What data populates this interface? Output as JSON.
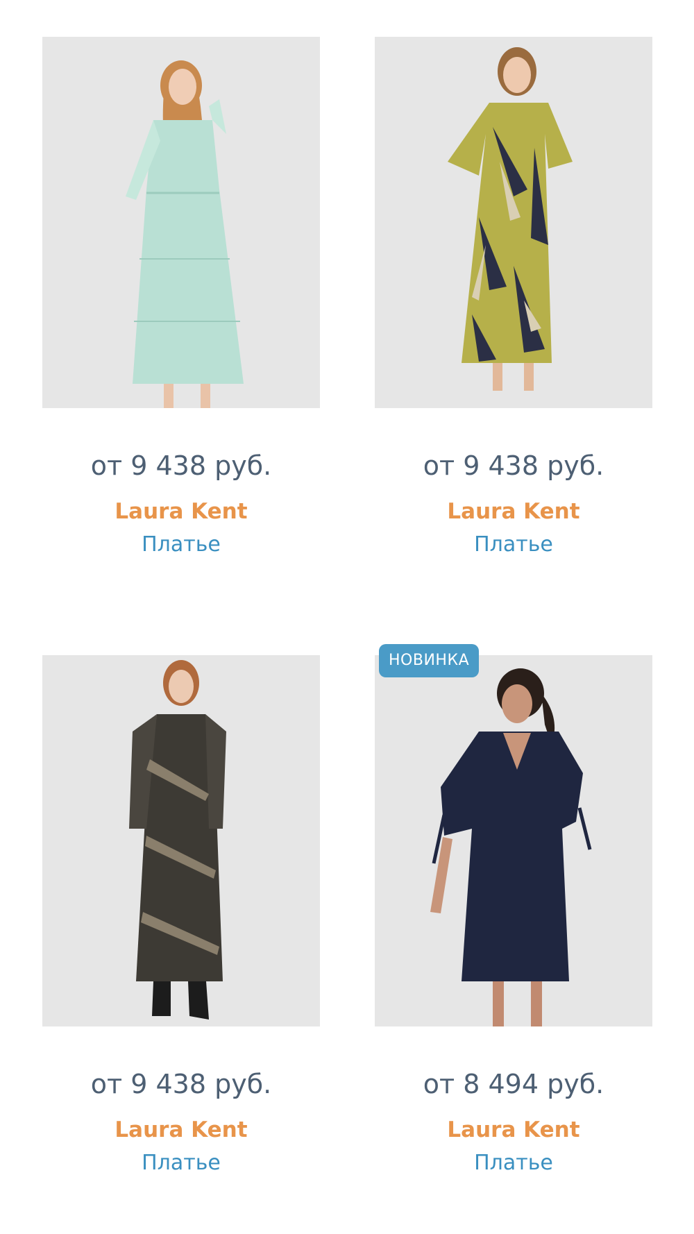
{
  "products": [
    {
      "price": "от 9 438 руб.",
      "brand": "Laura Kent",
      "type": "Платье",
      "badge": "",
      "image": "mint-green-tiered-midi-dress-photo"
    },
    {
      "price": "от 9 438 руб.",
      "brand": "Laura Kent",
      "type": "Платье",
      "badge": "",
      "image": "olive-navy-print-shirt-dress-photo"
    },
    {
      "price": "от 9 438 руб.",
      "brand": "Laura Kent",
      "type": "Платье",
      "badge": "",
      "image": "dark-patterned-maxi-dress-photo"
    },
    {
      "price": "от 8 494 руб.",
      "brand": "Laura Kent",
      "type": "Платье",
      "badge": "НОВИНКА",
      "image": "navy-vneck-shift-dress-photo"
    }
  ],
  "colors": {
    "price": "#4d5f73",
    "brand": "#e8944a",
    "type_link": "#3a8fc0",
    "badge_bg": "#4a9bc7",
    "photo_bg": "#e6e6e6"
  }
}
